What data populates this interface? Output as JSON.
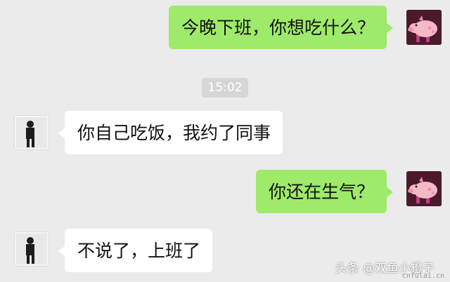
{
  "messages": [
    {
      "side": "right",
      "text": "今晚下班，你想吃什么？",
      "avatar": "pig-avatar"
    },
    {
      "side": "left",
      "text": "你自己吃饭，我约了同事",
      "avatar": "person-avatar"
    },
    {
      "side": "right",
      "text": "你还在生气？",
      "avatar": "pig-avatar"
    },
    {
      "side": "left",
      "text": "不说了，上班了",
      "avatar": "person-avatar"
    }
  ],
  "timestamp": "15:02",
  "watermark": {
    "main": "头条 @双鱼小橙子",
    "sub": "cnfulai.cn"
  },
  "colors": {
    "background": "#ebebeb",
    "my_bubble": "#9eea6a",
    "their_bubble": "#ffffff",
    "timestamp_bg": "#d6d6d6"
  }
}
